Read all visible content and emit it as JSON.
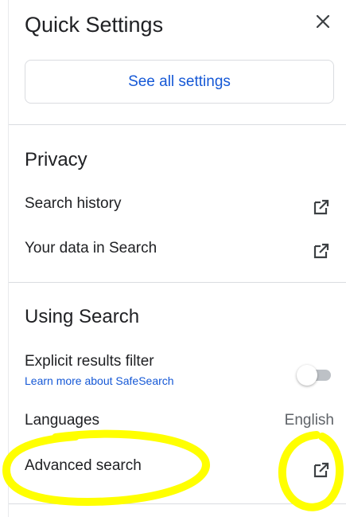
{
  "header": {
    "title": "Quick Settings",
    "close_icon": "close-icon"
  },
  "see_all_label": "See all settings",
  "privacy": {
    "title": "Privacy",
    "items": [
      {
        "label": "Search history",
        "icon": "open-external-icon"
      },
      {
        "label": "Your data in Search",
        "icon": "open-external-icon"
      }
    ]
  },
  "using_search": {
    "title": "Using Search",
    "explicit_filter": {
      "label": "Explicit results filter",
      "link": "Learn more about SafeSearch",
      "enabled": false
    },
    "languages": {
      "label": "Languages",
      "value": "English"
    },
    "advanced_search": {
      "label": "Advanced search",
      "icon": "open-external-icon"
    }
  },
  "colors": {
    "link": "#1558d6",
    "text": "#202124",
    "divider": "#dadce0",
    "highlight": "#ffff00"
  }
}
